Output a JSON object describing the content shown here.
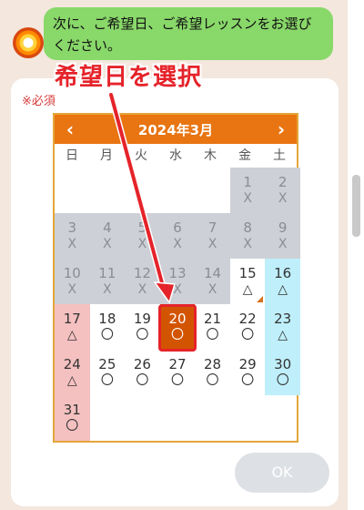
{
  "chat": {
    "message": "次に、ご希望日、ご希望レッスンをお選びください。"
  },
  "form": {
    "required_label": "※必須",
    "ok_label": "OK"
  },
  "calendar": {
    "month_label": "2024年3月",
    "prev_icon": "‹",
    "next_icon": "›",
    "weekdays": [
      "日",
      "月",
      "火",
      "水",
      "木",
      "金",
      "土"
    ],
    "days": [
      {
        "day": "1",
        "mark": "X",
        "status": "past"
      },
      {
        "day": "2",
        "mark": "X",
        "status": "past"
      },
      {
        "day": "3",
        "mark": "X",
        "status": "past"
      },
      {
        "day": "4",
        "mark": "X",
        "status": "past"
      },
      {
        "day": "5",
        "mark": "X",
        "status": "past"
      },
      {
        "day": "6",
        "mark": "X",
        "status": "past"
      },
      {
        "day": "7",
        "mark": "X",
        "status": "past"
      },
      {
        "day": "8",
        "mark": "X",
        "status": "past"
      },
      {
        "day": "9",
        "mark": "X",
        "status": "past"
      },
      {
        "day": "10",
        "mark": "X",
        "status": "past"
      },
      {
        "day": "11",
        "mark": "X",
        "status": "past"
      },
      {
        "day": "12",
        "mark": "X",
        "status": "past"
      },
      {
        "day": "13",
        "mark": "X",
        "status": "past"
      },
      {
        "day": "14",
        "mark": "X",
        "status": "past"
      },
      {
        "day": "15",
        "mark": "△",
        "status": "normal"
      },
      {
        "day": "16",
        "mark": "△",
        "status": "sat"
      },
      {
        "day": "17",
        "mark": "△",
        "status": "sun-holiday"
      },
      {
        "day": "18",
        "mark": "〇",
        "status": "normal"
      },
      {
        "day": "19",
        "mark": "〇",
        "status": "normal"
      },
      {
        "day": "20",
        "mark": "〇",
        "status": "selected"
      },
      {
        "day": "21",
        "mark": "〇",
        "status": "normal"
      },
      {
        "day": "22",
        "mark": "〇",
        "status": "normal"
      },
      {
        "day": "23",
        "mark": "△",
        "status": "sat"
      },
      {
        "day": "24",
        "mark": "△",
        "status": "sun-holiday"
      },
      {
        "day": "25",
        "mark": "〇",
        "status": "normal"
      },
      {
        "day": "26",
        "mark": "〇",
        "status": "normal"
      },
      {
        "day": "27",
        "mark": "〇",
        "status": "normal"
      },
      {
        "day": "28",
        "mark": "〇",
        "status": "normal"
      },
      {
        "day": "29",
        "mark": "〇",
        "status": "normal"
      },
      {
        "day": "30",
        "mark": "〇",
        "status": "sat"
      },
      {
        "day": "31",
        "mark": "〇",
        "status": "sun-holiday"
      }
    ],
    "first_weekday_index": 5
  },
  "annotation": {
    "text": "希望日を選択",
    "color": "#e5232a"
  },
  "colors": {
    "header": "#e87512",
    "selected": "#d35400",
    "bubble": "#89d86a"
  }
}
